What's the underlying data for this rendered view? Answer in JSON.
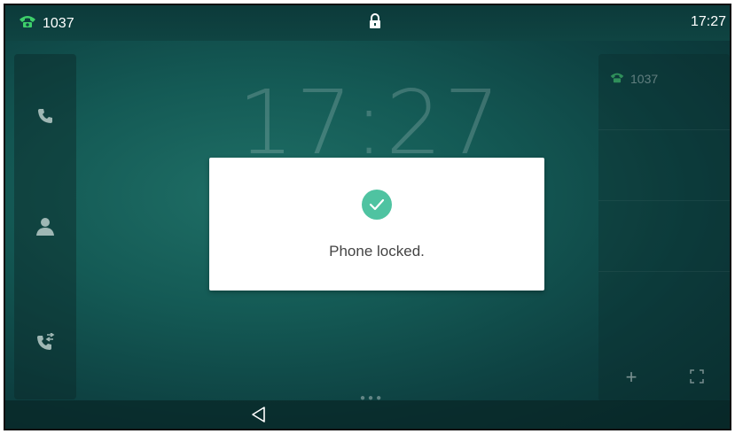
{
  "statusbar": {
    "account": "1037",
    "time": "17:27",
    "left_icon": "phone-handset-icon",
    "center_icon": "lock-icon"
  },
  "sidebar": {
    "items": [
      {
        "icon": "phone-icon"
      },
      {
        "icon": "contact-icon"
      },
      {
        "icon": "call-history-icon"
      }
    ]
  },
  "home": {
    "clock": "17:27"
  },
  "right_panel": {
    "account": "1037",
    "buttons": [
      {
        "icon": "plus-icon",
        "label": "+"
      },
      {
        "icon": "expand-icon"
      }
    ]
  },
  "dialog": {
    "message": "Phone locked.",
    "icon": "check-circle-icon",
    "icon_color": "#4fc3a1"
  },
  "navbar": {
    "back_icon": "back-triangle-icon"
  }
}
